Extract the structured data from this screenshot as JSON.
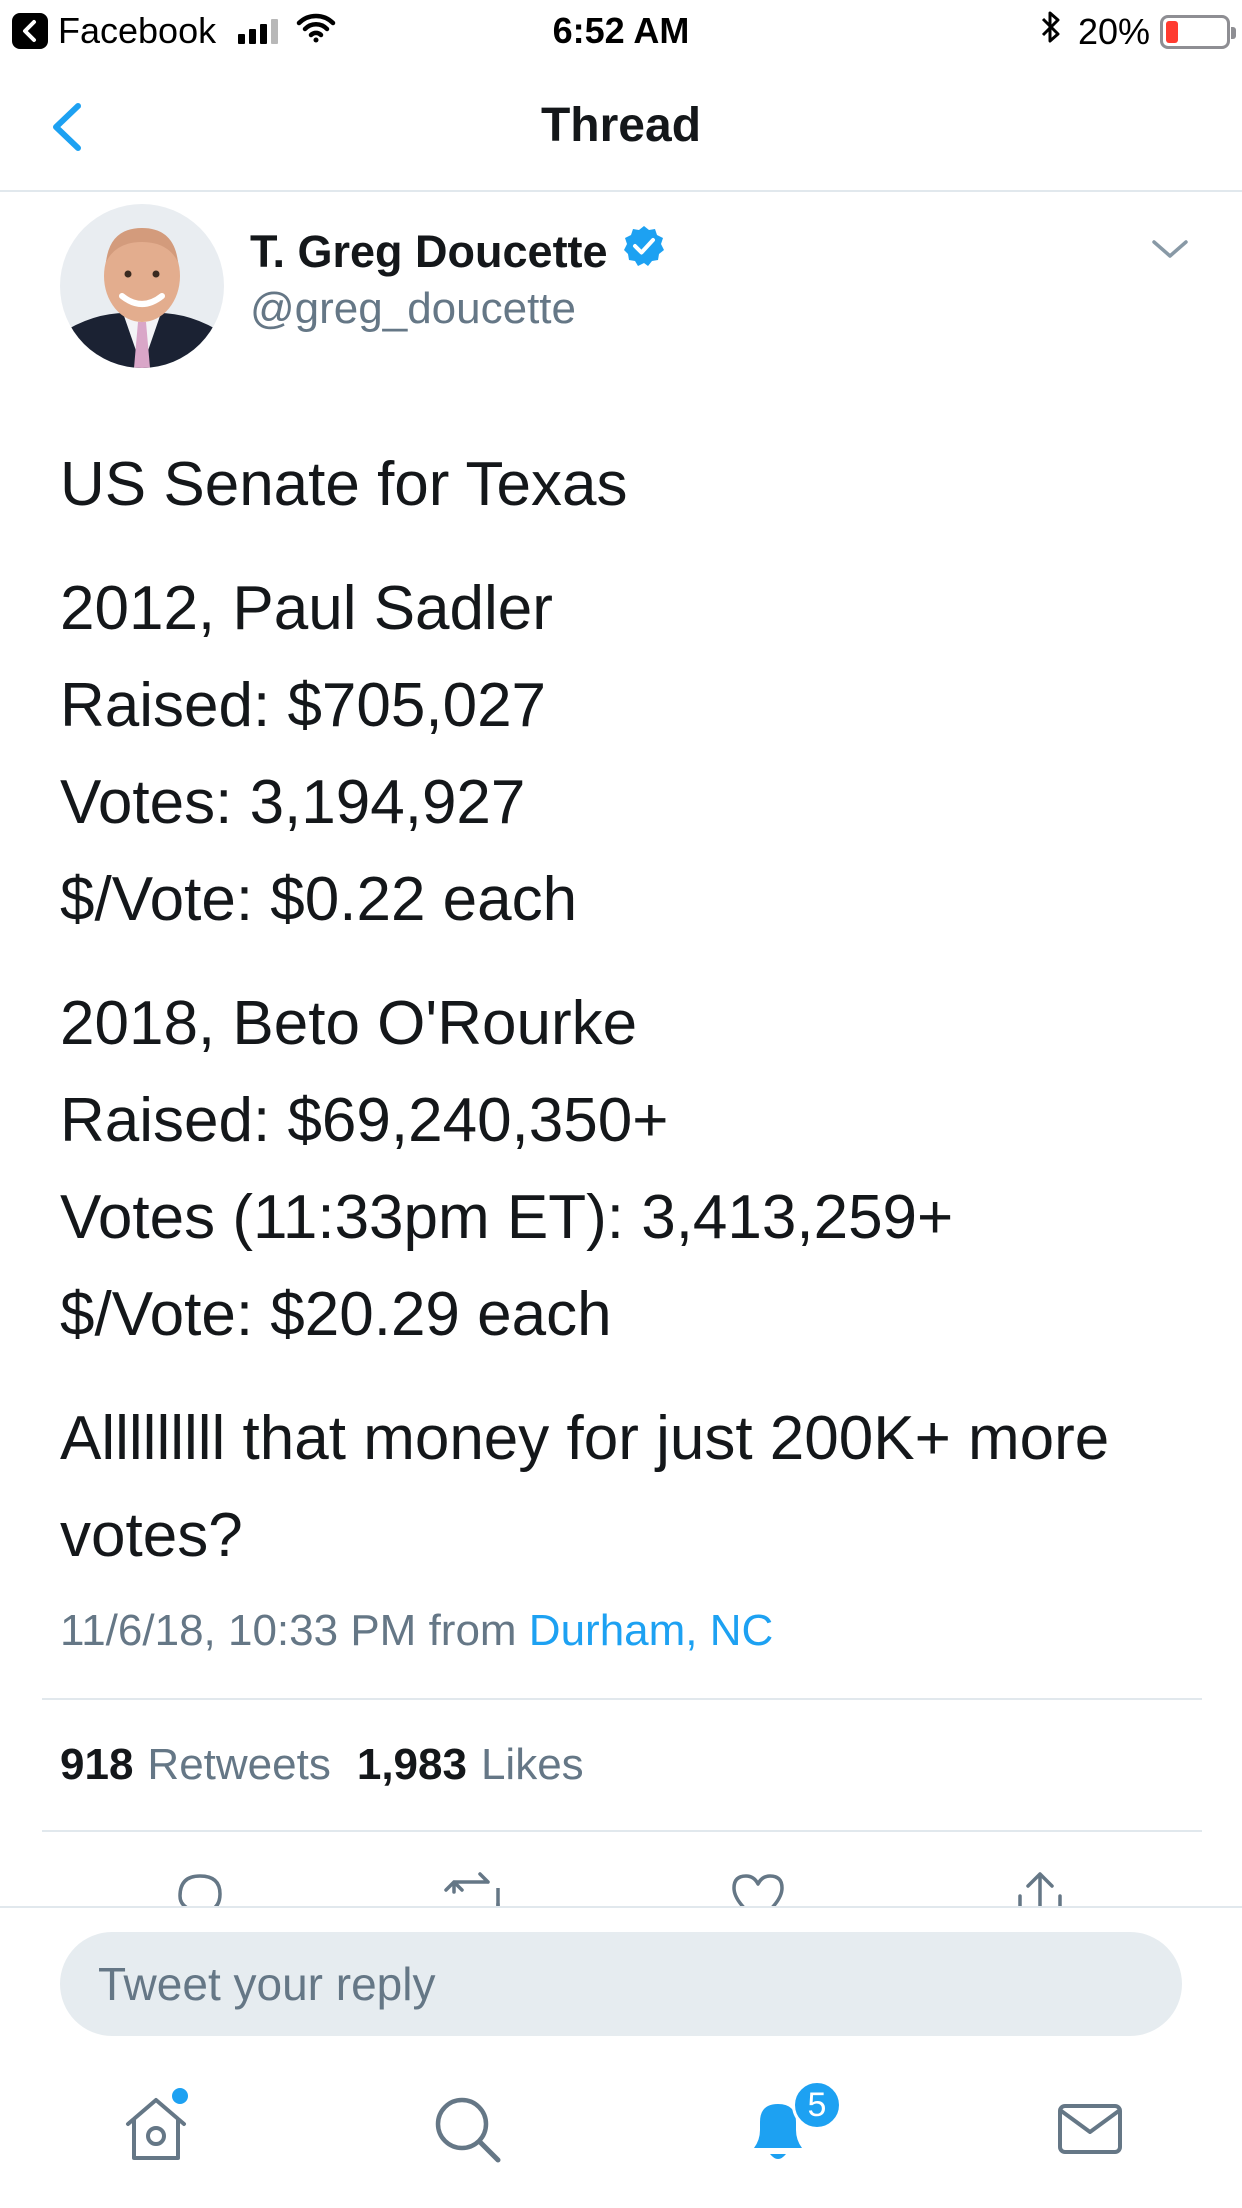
{
  "status_bar": {
    "back_app": "Facebook",
    "time": "6:52 AM",
    "battery": "20%",
    "battery_level": 0.2
  },
  "nav": {
    "title": "Thread"
  },
  "tweet": {
    "display_name": "T. Greg Doucette",
    "handle": "@greg_doucette",
    "paragraphs": [
      "US Senate for Texas",
      "2012, Paul Sadler\nRaised: $705,027\nVotes: 3,194,927\n$/Vote: $0.22 each",
      "2018, Beto O'Rourke\nRaised: $69,240,350+\nVotes (11:33pm ET): 3,413,259+\n$/Vote: $20.29 each",
      "Alllllllll that money for just 200K+ more votes?"
    ],
    "timestamp": "11/6/18, 10:33 PM",
    "from_label": "from",
    "location": "Durham, NC",
    "retweets_count": "918",
    "retweets_label": "Retweets",
    "likes_count": "1,983",
    "likes_label": "Likes"
  },
  "reply": {
    "placeholder": "Tweet your reply"
  },
  "tabbar": {
    "notifications_badge": "5",
    "icons": [
      "home-icon",
      "search-icon",
      "bell-icon",
      "mail-icon"
    ]
  },
  "colors": {
    "accent": "#1da1f2",
    "muted": "#657786",
    "text": "#14171a",
    "divider": "#e1e8ed"
  }
}
